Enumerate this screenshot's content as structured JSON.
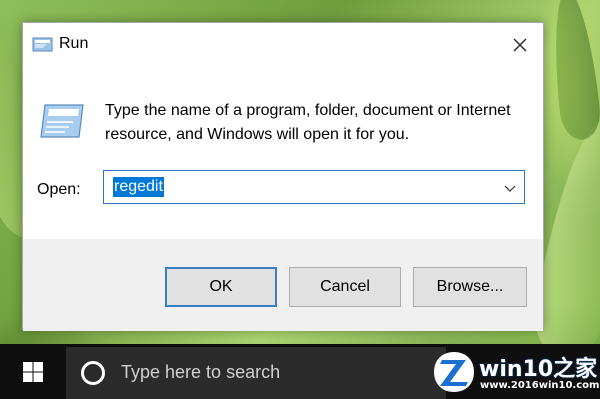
{
  "dialog": {
    "title": "Run",
    "prompt": "Type the name of a program, folder, document or Internet resource, and Windows will open it for you.",
    "open_label": "Open:",
    "open_value": "regedit",
    "buttons": {
      "ok": "OK",
      "cancel": "Cancel",
      "browse": "Browse..."
    }
  },
  "taskbar": {
    "search_placeholder": "Type here to search"
  },
  "watermark": {
    "brand": "win10之家",
    "url": "www.2016win10.com"
  },
  "icons": {
    "title": "run-icon",
    "dialog": "run-icon",
    "close": "close-icon",
    "dropdown": "chevron-down-icon",
    "start": "windows-logo-icon",
    "cortana": "cortana-icon"
  },
  "colors": {
    "accent": "#0078d7",
    "focus_border": "#2f72c9",
    "taskbar": "#0f0f0f",
    "searchbox": "#2b2b2b"
  }
}
